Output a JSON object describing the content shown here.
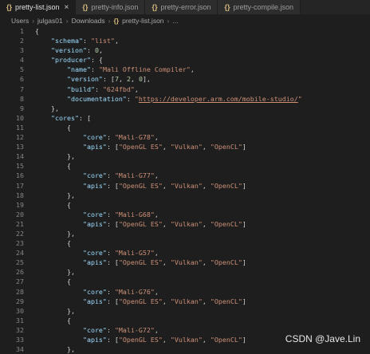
{
  "tabs": [
    {
      "label": "pretty-list.json",
      "active": true,
      "close": "×"
    },
    {
      "label": "pretty-info.json",
      "active": false
    },
    {
      "label": "pretty-error.json",
      "active": false
    },
    {
      "label": "pretty-compile.json",
      "active": false
    }
  ],
  "braces_icon": "{}",
  "breadcrumb": [
    "Users",
    "julgas01",
    "Downloads",
    "pretty-list.json",
    "..."
  ],
  "code_lines": [
    [
      [
        "p",
        "{"
      ]
    ],
    [
      [
        "p",
        "    "
      ],
      [
        "k",
        "\"schema\""
      ],
      [
        "p",
        ": "
      ],
      [
        "s",
        "\"list\""
      ],
      [
        "p",
        ","
      ]
    ],
    [
      [
        "p",
        "    "
      ],
      [
        "k",
        "\"version\""
      ],
      [
        "p",
        ": "
      ],
      [
        "n",
        "0"
      ],
      [
        "p",
        ","
      ]
    ],
    [
      [
        "p",
        "    "
      ],
      [
        "k",
        "\"producer\""
      ],
      [
        "p",
        ": {"
      ]
    ],
    [
      [
        "p",
        "        "
      ],
      [
        "k",
        "\"name\""
      ],
      [
        "p",
        ": "
      ],
      [
        "s",
        "\"Mali Offline Compiler\""
      ],
      [
        "p",
        ","
      ]
    ],
    [
      [
        "p",
        "        "
      ],
      [
        "k",
        "\"version\""
      ],
      [
        "p",
        ": ["
      ],
      [
        "n",
        "7"
      ],
      [
        "p",
        ", "
      ],
      [
        "n",
        "2"
      ],
      [
        "p",
        ", "
      ],
      [
        "n",
        "0"
      ],
      [
        "p",
        "],"
      ]
    ],
    [
      [
        "p",
        "        "
      ],
      [
        "k",
        "\"build\""
      ],
      [
        "p",
        ": "
      ],
      [
        "s",
        "\"624fbd\""
      ],
      [
        "p",
        ","
      ]
    ],
    [
      [
        "p",
        "        "
      ],
      [
        "k",
        "\"documentation\""
      ],
      [
        "p",
        ": "
      ],
      [
        "s",
        "\""
      ],
      [
        "u",
        "https://developer.arm.com/mobile-studio/"
      ],
      [
        "s",
        "\""
      ]
    ],
    [
      [
        "p",
        "    },"
      ]
    ],
    [
      [
        "p",
        "    "
      ],
      [
        "k",
        "\"cores\""
      ],
      [
        "p",
        ": ["
      ]
    ],
    [
      [
        "p",
        "        {"
      ]
    ],
    [
      [
        "p",
        "            "
      ],
      [
        "k",
        "\"core\""
      ],
      [
        "p",
        ": "
      ],
      [
        "s",
        "\"Mali-G78\""
      ],
      [
        "p",
        ","
      ]
    ],
    [
      [
        "p",
        "            "
      ],
      [
        "k",
        "\"apis\""
      ],
      [
        "p",
        ": ["
      ],
      [
        "s",
        "\"OpenGL ES\""
      ],
      [
        "p",
        ", "
      ],
      [
        "s",
        "\"Vulkan\""
      ],
      [
        "p",
        ", "
      ],
      [
        "s",
        "\"OpenCL\""
      ],
      [
        "p",
        "]"
      ]
    ],
    [
      [
        "p",
        "        },"
      ]
    ],
    [
      [
        "p",
        "        {"
      ]
    ],
    [
      [
        "p",
        "            "
      ],
      [
        "k",
        "\"core\""
      ],
      [
        "p",
        ": "
      ],
      [
        "s",
        "\"Mali-G77\""
      ],
      [
        "p",
        ","
      ]
    ],
    [
      [
        "p",
        "            "
      ],
      [
        "k",
        "\"apis\""
      ],
      [
        "p",
        ": ["
      ],
      [
        "s",
        "\"OpenGL ES\""
      ],
      [
        "p",
        ", "
      ],
      [
        "s",
        "\"Vulkan\""
      ],
      [
        "p",
        ", "
      ],
      [
        "s",
        "\"OpenCL\""
      ],
      [
        "p",
        "]"
      ]
    ],
    [
      [
        "p",
        "        },"
      ]
    ],
    [
      [
        "p",
        "        {"
      ]
    ],
    [
      [
        "p",
        "            "
      ],
      [
        "k",
        "\"core\""
      ],
      [
        "p",
        ": "
      ],
      [
        "s",
        "\"Mali-G68\""
      ],
      [
        "p",
        ","
      ]
    ],
    [
      [
        "p",
        "            "
      ],
      [
        "k",
        "\"apis\""
      ],
      [
        "p",
        ": ["
      ],
      [
        "s",
        "\"OpenGL ES\""
      ],
      [
        "p",
        ", "
      ],
      [
        "s",
        "\"Vulkan\""
      ],
      [
        "p",
        ", "
      ],
      [
        "s",
        "\"OpenCL\""
      ],
      [
        "p",
        "]"
      ]
    ],
    [
      [
        "p",
        "        },"
      ]
    ],
    [
      [
        "p",
        "        {"
      ]
    ],
    [
      [
        "p",
        "            "
      ],
      [
        "k",
        "\"core\""
      ],
      [
        "p",
        ": "
      ],
      [
        "s",
        "\"Mali-G57\""
      ],
      [
        "p",
        ","
      ]
    ],
    [
      [
        "p",
        "            "
      ],
      [
        "k",
        "\"apis\""
      ],
      [
        "p",
        ": ["
      ],
      [
        "s",
        "\"OpenGL ES\""
      ],
      [
        "p",
        ", "
      ],
      [
        "s",
        "\"Vulkan\""
      ],
      [
        "p",
        ", "
      ],
      [
        "s",
        "\"OpenCL\""
      ],
      [
        "p",
        "]"
      ]
    ],
    [
      [
        "p",
        "        },"
      ]
    ],
    [
      [
        "p",
        "        {"
      ]
    ],
    [
      [
        "p",
        "            "
      ],
      [
        "k",
        "\"core\""
      ],
      [
        "p",
        ": "
      ],
      [
        "s",
        "\"Mali-G76\""
      ],
      [
        "p",
        ","
      ]
    ],
    [
      [
        "p",
        "            "
      ],
      [
        "k",
        "\"apis\""
      ],
      [
        "p",
        ": ["
      ],
      [
        "s",
        "\"OpenGL ES\""
      ],
      [
        "p",
        ", "
      ],
      [
        "s",
        "\"Vulkan\""
      ],
      [
        "p",
        ", "
      ],
      [
        "s",
        "\"OpenCL\""
      ],
      [
        "p",
        "]"
      ]
    ],
    [
      [
        "p",
        "        },"
      ]
    ],
    [
      [
        "p",
        "        {"
      ]
    ],
    [
      [
        "p",
        "            "
      ],
      [
        "k",
        "\"core\""
      ],
      [
        "p",
        ": "
      ],
      [
        "s",
        "\"Mali-G72\""
      ],
      [
        "p",
        ","
      ]
    ],
    [
      [
        "p",
        "            "
      ],
      [
        "k",
        "\"apis\""
      ],
      [
        "p",
        ": ["
      ],
      [
        "s",
        "\"OpenGL ES\""
      ],
      [
        "p",
        ", "
      ],
      [
        "s",
        "\"Vulkan\""
      ],
      [
        "p",
        ", "
      ],
      [
        "s",
        "\"OpenCL\""
      ],
      [
        "p",
        "]"
      ]
    ],
    [
      [
        "p",
        "        },"
      ]
    ]
  ],
  "watermark": "CSDN @Jave.Lin",
  "colors": {
    "background": "#1e1e1e",
    "key": "#9cdcfe",
    "string": "#ce9178",
    "number": "#b5cea8",
    "json_icon": "#d7ba7d"
  }
}
